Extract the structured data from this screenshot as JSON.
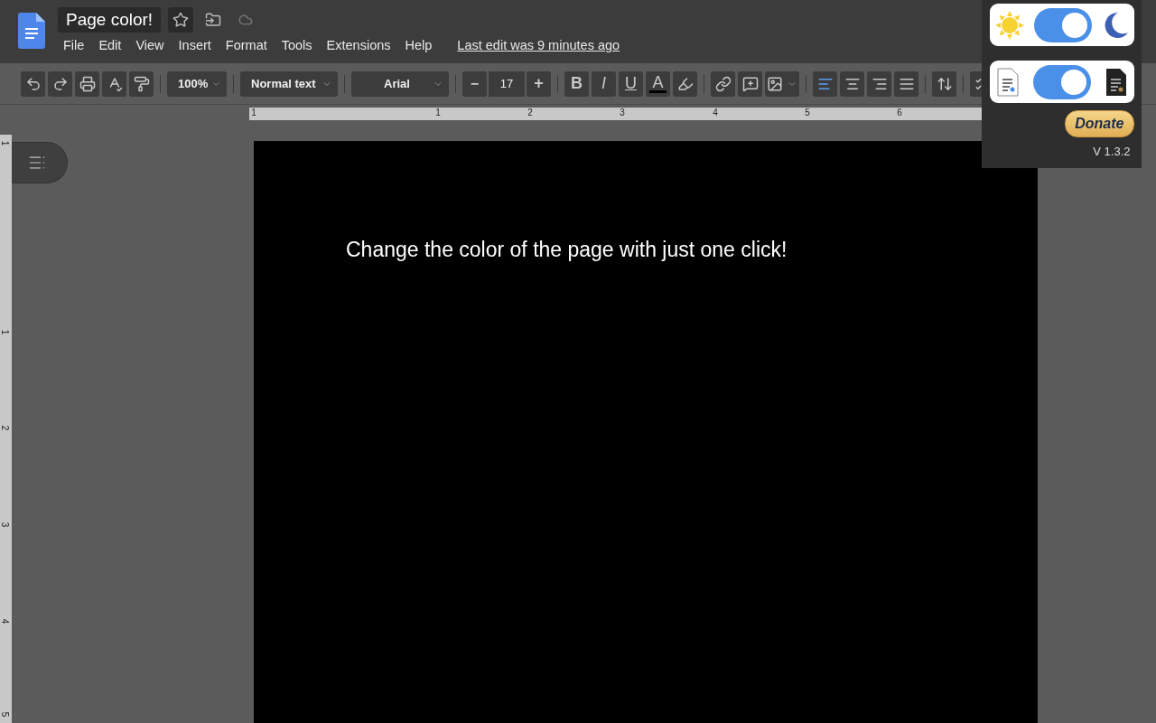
{
  "document": {
    "title": "Page color!",
    "starred": false
  },
  "menu": [
    "File",
    "Edit",
    "View",
    "Insert",
    "Format",
    "Tools",
    "Extensions",
    "Help"
  ],
  "last_edit": "Last edit was 9 minutes ago",
  "toolbar": {
    "zoom": "100%",
    "style": "Normal text",
    "font": "Arial",
    "font_size": "17",
    "minus": "−",
    "plus": "+",
    "format_buttons": [
      {
        "kind": "bold",
        "label": "B"
      },
      {
        "kind": "italic",
        "label": "I"
      },
      {
        "kind": "underline",
        "label": "U"
      },
      {
        "kind": "color",
        "label": "A"
      }
    ],
    "alignment": [
      {
        "kind": "left",
        "selected": true
      },
      {
        "kind": "center",
        "selected": false
      },
      {
        "kind": "right",
        "selected": false
      },
      {
        "kind": "justify",
        "selected": false
      }
    ]
  },
  "ruler": {
    "labels": [
      "1",
      "1",
      "2",
      "3",
      "4",
      "5",
      "6"
    ],
    "vertical_labels": [
      "1",
      "1",
      "2",
      "3",
      "4",
      "5"
    ]
  },
  "page": {
    "text": "Change the color of the page with just one click!"
  },
  "extension_popup": {
    "dark_mode": {
      "on": true
    },
    "dark_page": {
      "on": true
    },
    "donate": "Donate",
    "version": "V 1.3.2"
  }
}
